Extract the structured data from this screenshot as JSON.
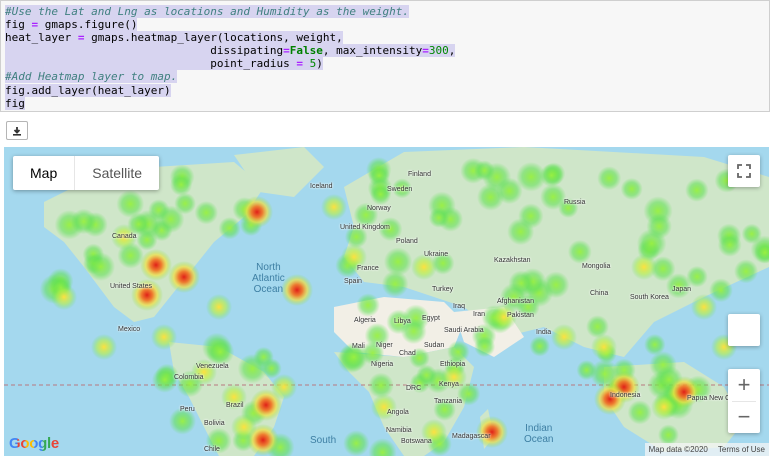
{
  "code_cell": {
    "lines": [
      [
        {
          "t": "#Use the Lat and Lng as locations and Humidity as the weight.",
          "c": "comment"
        }
      ],
      [
        {
          "t": "fig "
        },
        {
          "t": "=",
          "c": "op"
        },
        {
          "t": " gmaps.figure()"
        }
      ],
      [
        {
          "t": "heat_layer "
        },
        {
          "t": "=",
          "c": "op"
        },
        {
          "t": " gmaps.heatmap_layer(locations, weight,"
        }
      ],
      [
        {
          "t": "                               dissipating"
        },
        {
          "t": "=",
          "c": "op"
        },
        {
          "t": "False",
          "c": "kw"
        },
        {
          "t": ", max_intensity"
        },
        {
          "t": "=",
          "c": "op"
        },
        {
          "t": "300",
          "c": "num"
        },
        {
          "t": ","
        }
      ],
      [
        {
          "t": "                               point_radius "
        },
        {
          "t": "=",
          "c": "op"
        },
        {
          "t": " "
        },
        {
          "t": "5",
          "c": "num"
        },
        {
          "t": ")"
        }
      ],
      [
        {
          "t": "#Add Heatmap layer to map.",
          "c": "comment"
        }
      ],
      [
        {
          "t": "fig.add_layer(heat_layer)"
        }
      ],
      [
        {
          "t": "fig"
        }
      ]
    ]
  },
  "toolbar": {
    "download_icon": "download-icon"
  },
  "map": {
    "type_buttons": [
      "Map",
      "Satellite"
    ],
    "active_type": "Map",
    "fullscreen_icon": "fullscreen-icon",
    "zoom_in_label": "+",
    "zoom_out_label": "−",
    "google_logo": "Google",
    "attribution": {
      "data": "Map data ©2020",
      "terms": "Terms of Use"
    },
    "colors": {
      "ocean": "#a4d8ee",
      "land": "#cfe6c9",
      "desert": "#f2efe6",
      "heat_low": "#7cf04a",
      "heat_mid": "#f0e040",
      "heat_high": "#e03020"
    },
    "oceans": [
      {
        "name": "North Atlantic Ocean",
        "lines": [
          "North",
          "Atlantic",
          "Ocean"
        ]
      },
      {
        "name": "Indian Ocean",
        "lines": [
          "Indian",
          "Ocean"
        ]
      },
      {
        "name": "South",
        "lines": [
          "South"
        ]
      }
    ],
    "places": [
      "Iceland",
      "Finland",
      "Sweden",
      "Russia",
      "Norway",
      "United Kingdom",
      "Poland",
      "Canada",
      "Ukraine",
      "Kazakhstan",
      "Mongolia",
      "France",
      "Spain",
      "Turkey",
      "China",
      "United States",
      "South Korea",
      "Japan",
      "Iraq",
      "Afghanistan",
      "Iran",
      "Pakistan",
      "Algeria",
      "Libya",
      "Egypt",
      "Saudi Arabia",
      "India",
      "Mexico",
      "Mali",
      "Niger",
      "Chad",
      "Sudan",
      "Venezuela",
      "Colombia",
      "Nigeria",
      "Ethiopia",
      "DRC",
      "Kenya",
      "Brazil",
      "Peru",
      "Tanzania",
      "Bolivia",
      "Angola",
      "Indonesia",
      "Papua New Guinea",
      "Namibia",
      "Madagascar",
      "Botswana",
      "Chile"
    ]
  }
}
